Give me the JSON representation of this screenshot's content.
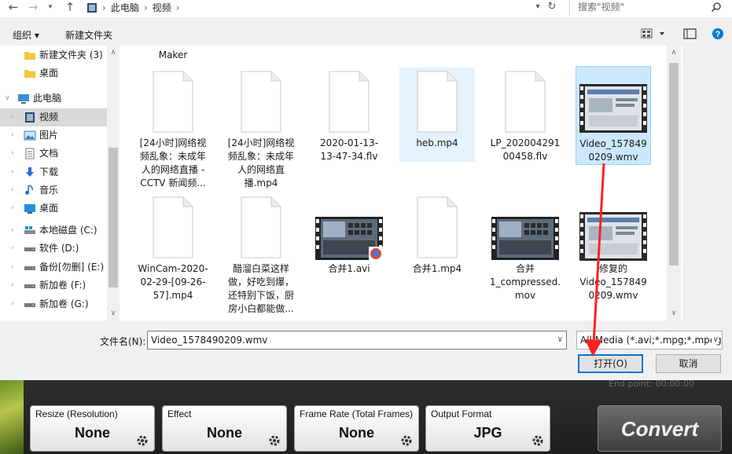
{
  "address": {
    "crumbs": [
      "此电脑",
      "视频"
    ],
    "search_placeholder": "搜索\"视频\""
  },
  "toolbar": {
    "organize": "组织 ▾",
    "new_folder": "新建文件夹"
  },
  "nav": {
    "items": [
      {
        "label": "新建文件夹 (3)",
        "icon": "folder-icon"
      },
      {
        "label": "桌面",
        "icon": "folder-icon"
      },
      {
        "label": "此电脑",
        "icon": "computer-icon"
      },
      {
        "label": "视频",
        "icon": "video-folder-icon"
      },
      {
        "label": "图片",
        "icon": "pictures-icon"
      },
      {
        "label": "文档",
        "icon": "documents-icon"
      },
      {
        "label": "下载",
        "icon": "download-icon"
      },
      {
        "label": "音乐",
        "icon": "music-icon"
      },
      {
        "label": "桌面",
        "icon": "desktop-icon"
      },
      {
        "label": "本地磁盘 (C:)",
        "icon": "drive-icon"
      },
      {
        "label": "软件 (D:)",
        "icon": "drive-icon"
      },
      {
        "label": "备份[勿删] (E:)",
        "icon": "drive-icon"
      },
      {
        "label": "新加卷 (F:)",
        "icon": "drive-icon"
      },
      {
        "label": "新加卷 (G:)",
        "icon": "drive-icon"
      }
    ]
  },
  "files": {
    "partial_top": "Maker",
    "items": [
      {
        "name": "[24小时]网络视频乱象：未成年人的网络直播 - CCTV 新闻频..."
      },
      {
        "name": "[24小时]网络视频乱象：未成年人的网络直播.mp4"
      },
      {
        "name": "2020-01-13-13-47-34.flv"
      },
      {
        "name": "heb.mp4"
      },
      {
        "name": "LP_20200429100458.flv"
      },
      {
        "name": "Video_1578490209.wmv"
      },
      {
        "name": "WinCam-2020-02-29-[09-26-57].mp4"
      },
      {
        "name": "醋溜白菜这样做，好吃到爆，还特别下饭，厨房小白都能做..."
      },
      {
        "name": "合并1.avi"
      },
      {
        "name": "合并1.mp4"
      },
      {
        "name": "合并1_compressed.mov"
      },
      {
        "name": "修复的Video_1578490209.wmv"
      }
    ]
  },
  "bottom": {
    "filename_label": "文件名(N):",
    "filename_value": "Video_1578490209.wmv",
    "filetype_value": "All Media (*.avi;*.mpg;*.mpeg",
    "open_label": "打开(O)",
    "cancel_label": "取消"
  },
  "app": {
    "end_point": "End point: 00:00:00",
    "options": [
      {
        "title": "Resize (Resolution)",
        "value": "None"
      },
      {
        "title": "Effect",
        "value": "None"
      },
      {
        "title": "Frame Rate (Total Frames)",
        "value": "None"
      },
      {
        "title": "Output Format",
        "value": "JPG"
      }
    ],
    "convert_label": "Convert"
  },
  "colors": {
    "selection": "#cce8ff",
    "accent": "#0078d7",
    "annotation": "#ff2020"
  }
}
